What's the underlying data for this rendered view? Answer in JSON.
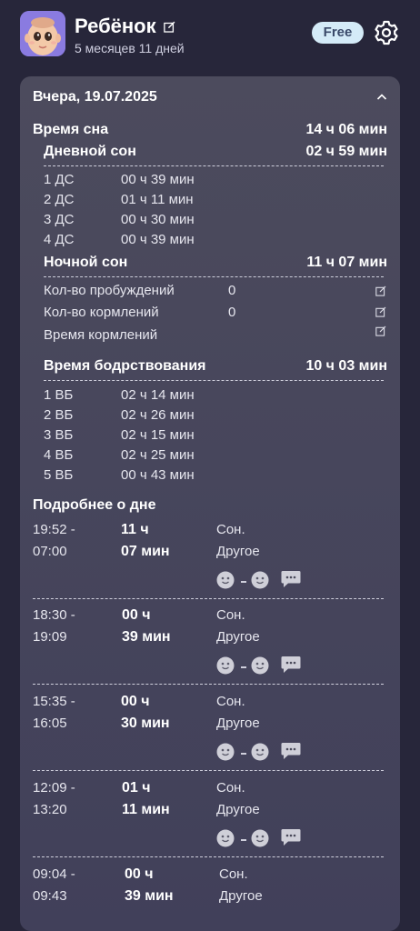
{
  "header": {
    "child_name": "Ребёнок",
    "age": "5 месяцев 11 дней",
    "badge": "Free"
  },
  "card": {
    "date": "Вчера, 19.07.2025",
    "sleep_total": {
      "label": "Время сна",
      "value": "14 ч 06 мин"
    },
    "day_sleep": {
      "label": "Дневной сон",
      "value": "02 ч 59 мин"
    },
    "day_naps": [
      {
        "name": "1 ДС",
        "value": "00 ч 39 мин"
      },
      {
        "name": "2 ДС",
        "value": "01 ч 11 мин"
      },
      {
        "name": "3 ДС",
        "value": "00 ч 30 мин"
      },
      {
        "name": "4 ДС",
        "value": "00 ч 39 мин"
      }
    ],
    "night_sleep": {
      "label": "Ночной сон",
      "value": "11 ч 07 мин"
    },
    "night_stats": [
      {
        "label": "Кол-во пробуждений",
        "value": "0"
      },
      {
        "label": "Кол-во кормлений",
        "value": "0"
      },
      {
        "label": "Время кормлений",
        "value": ""
      }
    ],
    "awake": {
      "label": "Время бодрствования",
      "value": "10 ч 03 мин"
    },
    "awake_windows": [
      {
        "name": "1 ВБ",
        "value": "02 ч 14 мин"
      },
      {
        "name": "2 ВБ",
        "value": "02 ч 26 мин"
      },
      {
        "name": "3 ВБ",
        "value": "02 ч 15 мин"
      },
      {
        "name": "4 ВБ",
        "value": "02 ч 25 мин"
      },
      {
        "name": "5 ВБ",
        "value": "00 ч 43 мин"
      }
    ],
    "details_title": "Подробнее о дне",
    "details": [
      {
        "start": "19:52 -",
        "end": "07:00",
        "hours": "11 ч",
        "minutes": "07 мин",
        "type": "Сон.",
        "place": "Другое"
      },
      {
        "start": "18:30 -",
        "end": "19:09",
        "hours": "00 ч",
        "minutes": "39 мин",
        "type": "Сон.",
        "place": "Другое"
      },
      {
        "start": "15:35 -",
        "end": "16:05",
        "hours": "00 ч",
        "minutes": "30 мин",
        "type": "Сон.",
        "place": "Другое"
      },
      {
        "start": "12:09 -",
        "end": "13:20",
        "hours": "01 ч",
        "minutes": "11 мин",
        "type": "Сон.",
        "place": "Другое"
      },
      {
        "start": "09:04 -",
        "end": "09:43",
        "hours": "00 ч",
        "minutes": "39 мин",
        "type": "Сон.",
        "place": "Другое"
      }
    ]
  }
}
